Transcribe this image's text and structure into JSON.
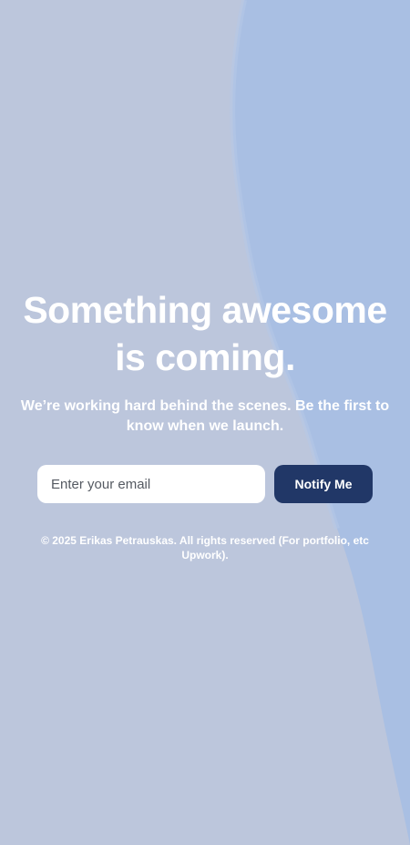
{
  "hero": {
    "headline_line1": "Something awesome",
    "headline_line2": "is coming.",
    "subtext": "We’re working hard behind the scenes. Be the first to know when we launch."
  },
  "signup": {
    "email_placeholder": "Enter your email",
    "button_label": "Notify Me"
  },
  "footer": {
    "copyright": "© 2025 Erikas Petrauskas. All rights reserved (For portfolio, etc Upwork)."
  },
  "colors": {
    "background": "#bcc6dc",
    "accent_wave": "#a8bfe4",
    "button": "#213767",
    "text": "#ffffff"
  }
}
